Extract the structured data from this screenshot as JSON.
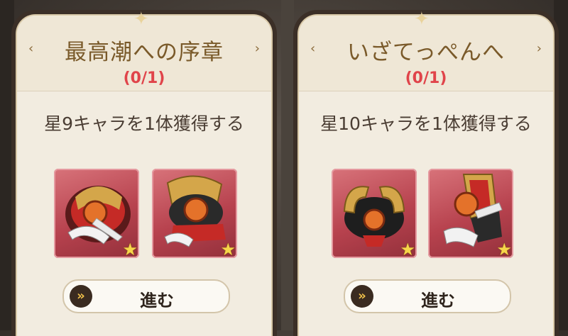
{
  "cards": [
    {
      "title": "最高潮への序章",
      "progress": "(0/1)",
      "description": "星9キャラを1体獲得する",
      "button_label": "進む",
      "rewards": [
        "gauntlet-reward-icon",
        "boots-reward-icon"
      ]
    },
    {
      "title": "いざてっぺんへ",
      "progress": "(0/1)",
      "description": "星10キャラを1体獲得する",
      "button_label": "進む",
      "rewards": [
        "ring-reward-icon",
        "greave-reward-icon"
      ]
    }
  ],
  "icons": {
    "left_arrow": "‹",
    "right_arrow": "›",
    "star": "★",
    "button_arrow": "»",
    "top_ornament": "✦"
  },
  "colors": {
    "progress": "#e0444a",
    "title": "#7a5a2a",
    "reward_bg": "#b7424e"
  }
}
